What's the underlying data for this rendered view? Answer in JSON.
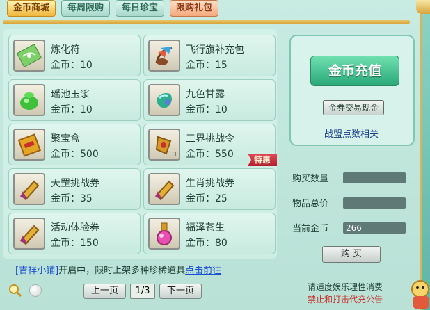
{
  "tabs": [
    {
      "label": "金币商城"
    },
    {
      "label": "每周限购"
    },
    {
      "label": "每日珍宝"
    },
    {
      "label": "限购礼包"
    }
  ],
  "items": [
    {
      "name": "炼化符",
      "price": "金币：10",
      "icon": "talisman-icon"
    },
    {
      "name": "飞行旗补充包",
      "price": "金币：15",
      "icon": "flag-pack-icon"
    },
    {
      "name": "瑶池玉浆",
      "price": "金币：10",
      "icon": "jade-jar-icon"
    },
    {
      "name": "九色甘露",
      "price": "金币：10",
      "icon": "gem-icon"
    },
    {
      "name": "聚宝盒",
      "price": "金币：500",
      "icon": "treasure-box-icon"
    },
    {
      "name": "三界挑战令",
      "price": "金币：550",
      "icon": "challenge-token-icon",
      "qty": "1",
      "badge": "特惠"
    },
    {
      "name": "天罡挑战券",
      "price": "金币：35",
      "icon": "scroll-icon"
    },
    {
      "name": "生肖挑战券",
      "price": "金币：25",
      "icon": "scroll-icon"
    },
    {
      "name": "活动体验券",
      "price": "金币：150",
      "icon": "scroll-icon"
    },
    {
      "name": "福泽苍生",
      "price": "金币：80",
      "icon": "potion-icon"
    }
  ],
  "promo": {
    "bracket": "[吉祥小铺]",
    "text": "开启中，限时上架多种珍稀道具",
    "link": "点击前往"
  },
  "pager": {
    "prev": "上一页",
    "page": "1/3",
    "next": "下一页"
  },
  "recharge": {
    "main": "金币充值",
    "exchange": "金券交易现金",
    "alliance": "战盟点数相关"
  },
  "purchase": {
    "qty_label": "购买数量",
    "qty_value": "",
    "total_label": "物品总价",
    "total_value": "",
    "gold_label": "当前金币",
    "gold_value": "266",
    "buy": "购 买"
  },
  "notice": {
    "line1": "请适度娱乐理性消费",
    "line2": "禁止和打击代充公告"
  }
}
